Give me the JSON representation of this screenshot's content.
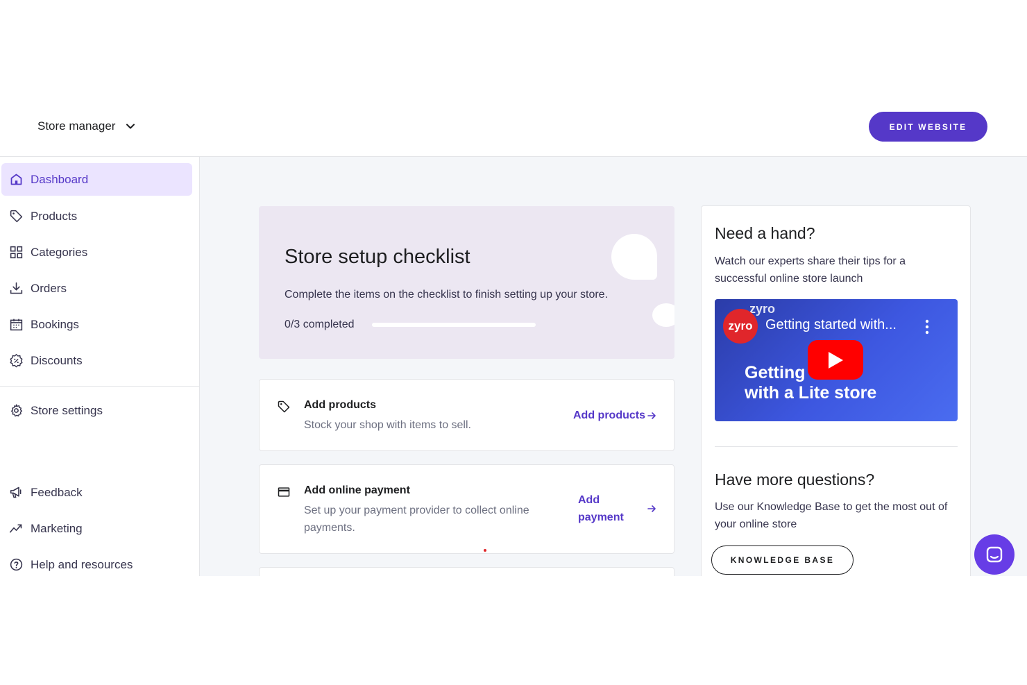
{
  "header": {
    "store_label": "Store manager",
    "edit_button": "EDIT WEBSITE"
  },
  "sidebar": {
    "items": [
      {
        "label": "Dashboard",
        "icon": "home-icon",
        "active": true
      },
      {
        "label": "Products",
        "icon": "tag-icon"
      },
      {
        "label": "Categories",
        "icon": "grid-icon"
      },
      {
        "label": "Orders",
        "icon": "download-icon"
      },
      {
        "label": "Bookings",
        "icon": "calendar-icon"
      },
      {
        "label": "Discounts",
        "icon": "discount-badge-icon"
      },
      {
        "label": "Store settings",
        "icon": "gear-icon"
      },
      {
        "label": "Feedback",
        "icon": "megaphone-icon"
      },
      {
        "label": "Marketing",
        "icon": "trend-icon"
      },
      {
        "label": "Help and resources",
        "icon": "help-circle-icon"
      }
    ]
  },
  "checklist": {
    "title": "Store setup checklist",
    "description": "Complete the items on the checklist to finish setting up your store.",
    "progress_label": "0/3 completed",
    "progress_fraction": 0,
    "tasks": [
      {
        "title": "Add products",
        "description": "Stock your shop with items to sell.",
        "link": "Add products",
        "icon": "tag-icon"
      },
      {
        "title": "Add online payment",
        "description_line1": "Set up your payment provider to collect online",
        "description_line2": "payments.",
        "link_line1": "Add",
        "link_line2": "payment",
        "icon": "credit-card-icon"
      }
    ]
  },
  "help": {
    "title": "Need a hand?",
    "description": "Watch our experts share their tips for a successful online store launch",
    "video": {
      "logo_text": "zyro",
      "brand_text": "zyro",
      "title": "Getting started with...",
      "overlay_line1": "Getting s",
      "overlay_line2": "with a Lite store"
    },
    "title2": "Have more questions?",
    "description2": "Use our Knowledge Base to get the most out of your online store",
    "kb_button": "KNOWLEDGE BASE"
  },
  "colors": {
    "accent": "#5538c8",
    "active_bg": "#ebe4ff",
    "hero_bg": "#ece7f2",
    "chat": "#673de6",
    "play": "#ff0000"
  }
}
